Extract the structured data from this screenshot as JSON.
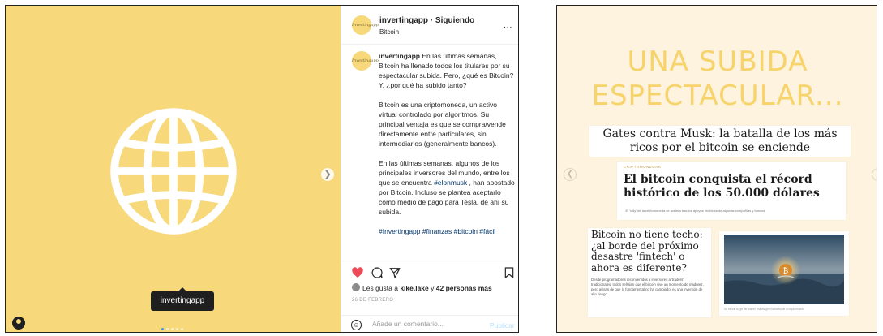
{
  "instagram": {
    "header": {
      "username": "invertingapp",
      "separator": " · ",
      "follow_status": "Siguiendo",
      "subtitle": "Bitcoin",
      "more": "...",
      "avatar_text": "Invertingapp"
    },
    "caption": {
      "username": "invertingapp",
      "p1": " En las últimas semanas, Bitcoin ha llenado todos los titulares por su espectacular subida. Pero, ¿qué es Bitcoin? Y, ¿por qué ha subido tanto?",
      "p2": "Bitcoin es una criptomoneda, un activo virtual controlado por algoritmos. Su principal ventaja es que se compra/vende directamente entre particulares, sin intermediarios (generalmente bancos).",
      "p3_a": "En las últimas semanas, algunos de los principales inversores del mundo, entre los que se encuentra ",
      "p3_hashtag": "#elonmusk",
      "p3_b": " , han apostado por Bitcoin. Incluso se plantea aceptarlo como medio de pago para Tesla, de ahí su subida.",
      "hashtags": "#Invertingapp #finanzas #bitcoin #fácil"
    },
    "likes": {
      "prefix": "Les gusta a ",
      "user": "kike.lake",
      "middle": " y ",
      "count": "42 personas más"
    },
    "date": "26 DE FEBRERO",
    "comment_placeholder": "Añade un comentario...",
    "publish_label": "Publicar",
    "image_tag": "invertingapp",
    "carousel": {
      "count": 5,
      "active": 0
    },
    "colors": {
      "image_bg": "#f7d87a",
      "heart": "#ed4956",
      "link": "#003569"
    }
  },
  "slide": {
    "title": "UNA SUBIDA ESPECTACULAR...",
    "headline_1": "Gates contra Musk: la batalla de los más ricos por el bitcoin se enciende",
    "clip_2": {
      "kicker": "CRIPTOMONEDAS",
      "title": "El bitcoin conquista el récord histórico de los 50.000 dólares",
      "subtitle": "• El 'rally' de la criptomoneda se acelera tras los apoyos recibidos de algunas compañías y bancos"
    },
    "clip_3": {
      "title": "Bitcoin no tiene techo: ¿al borde del próximo desastre 'fintech' o ahora es diferente?",
      "body": "Desde programadores reconvertidos a inversores a 'traders' tradicionales, todos señalan que el bitcoin vive un momento de madurez, pero avisan de que lo fundamental no ha cambiado: es una inversión de alto riesgo"
    },
    "photo_caption": "Un bitcoin surge del mar en una imagen ilustrativa de la criptomoneda",
    "colors": {
      "bg": "#fdf3df",
      "title": "#f7d36b"
    }
  }
}
